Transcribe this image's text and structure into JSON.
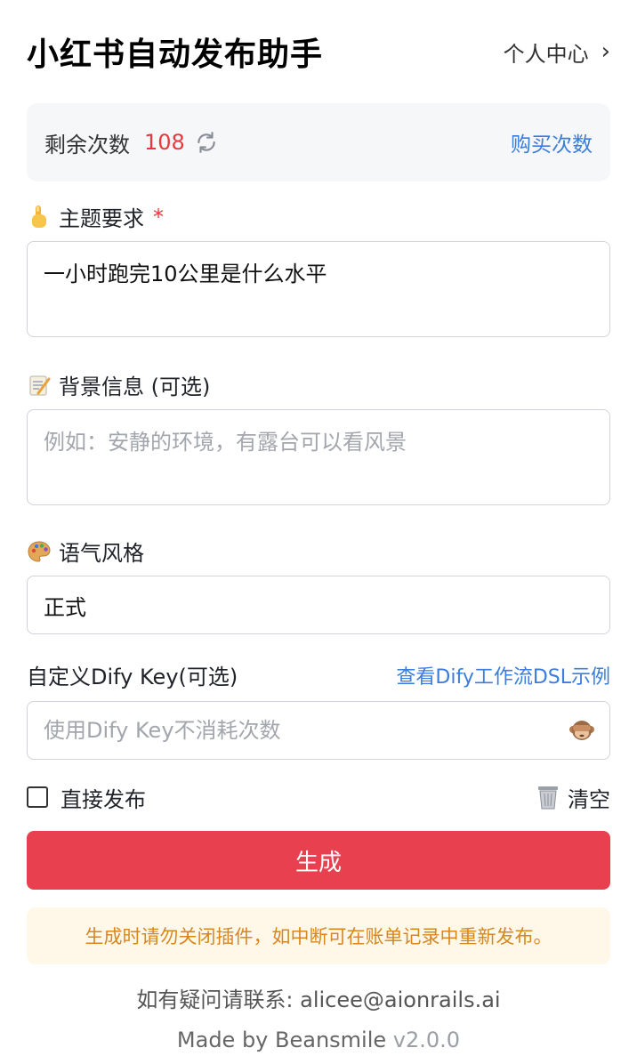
{
  "header": {
    "title": "小红书自动发布助手",
    "profile_label": "个人中心",
    "profile_chevron": "chevron-right-icon"
  },
  "quota": {
    "label": "剩余次数",
    "count": "108",
    "refresh_icon": "refresh-icon",
    "buy_label": "购买次数"
  },
  "form": {
    "topic": {
      "emoji": "pointing-finger-icon",
      "label": "主题要求",
      "required_mark": "*",
      "value": "一小时跑完10公里是什么水平"
    },
    "background": {
      "emoji": "memo-icon",
      "label": "背景信息 (可选)",
      "placeholder": "例如：安静的环境，有露台可以看风景"
    },
    "tone": {
      "emoji": "palette-icon",
      "label": "语气风格",
      "selected": "正式"
    },
    "dify_key": {
      "label": "自定义Dify Key(可选)",
      "dsl_link": "查看Dify工作流DSL示例",
      "placeholder": "使用Dify Key不消耗次数",
      "toggle_icon": "see-no-evil-monkey-icon"
    },
    "direct_publish_label": "直接发布",
    "direct_publish_checked": false,
    "clear_label": "清空",
    "clear_icon": "trash-icon"
  },
  "generate_label": "生成",
  "notice": "生成时请勿关闭插件，如中断可在账单记录中重新发布。",
  "footer": {
    "contact": "如有疑问请联系: alicee@aionrails.ai",
    "made_by": "Made by Beansmile",
    "version": "v2.0.0"
  },
  "colors": {
    "accent_red": "#e8404e",
    "link_blue": "#3b7ddd",
    "count_red": "#e8383d",
    "notice_bg": "#fff8e8",
    "notice_text": "#d8871e"
  }
}
